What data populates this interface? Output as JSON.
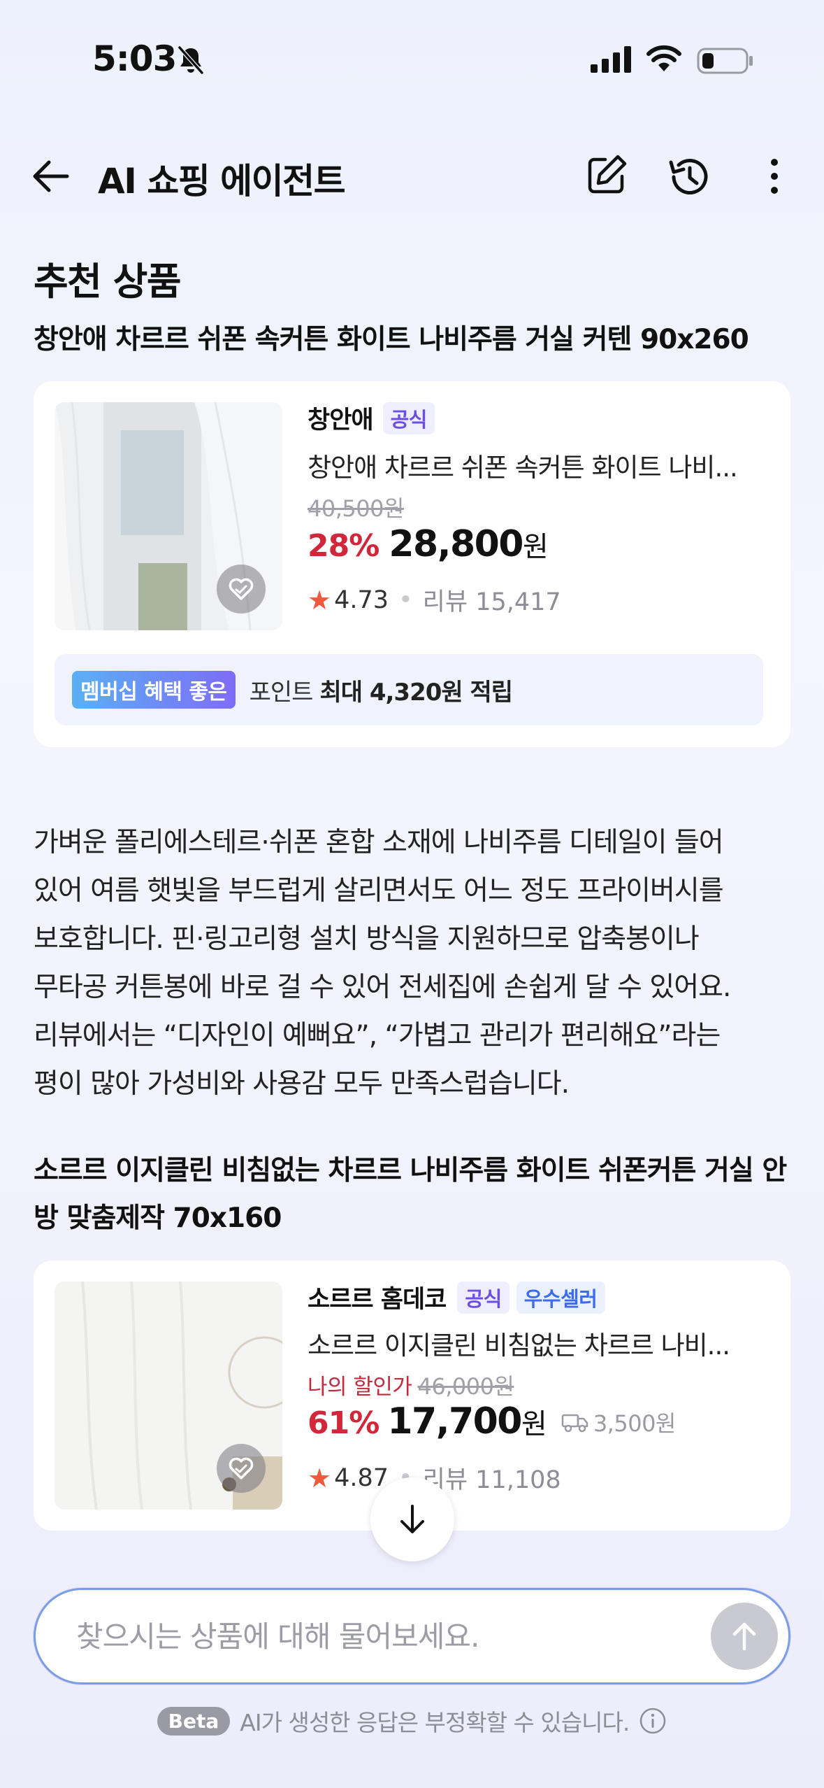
{
  "status_bar": {
    "time": "5:03"
  },
  "header": {
    "title": "AI 쇼핑 에이전트"
  },
  "section_title": "추천 상품",
  "products": [
    {
      "title": "창안애 차르르 쉬폰 속커튼 화이트 나비주름 거실 커텐 90x260",
      "seller": "창안애",
      "badges": [
        "공식"
      ],
      "name": "창안애 차르르 쉬폰 속커튼 화이트 나비...",
      "original_price": "40,500원",
      "discount": "28%",
      "price": "28,800",
      "price_unit": "원",
      "rating": "4.73",
      "review": "리뷰 15,417",
      "benefit": {
        "tag": "멤버십 혜택 좋은",
        "prefix": "포인트",
        "amount": "최대 4,320원 적립"
      }
    },
    {
      "title": "소르르 이지클린 비침없는 차르르 나비주름 화이트 쉬폰커튼 거실 안방 맞춤제작 70x160",
      "seller": "소르르 홈데코",
      "badges": [
        "공식",
        "우수셀러"
      ],
      "name": "소르르 이지클린 비침없는 차르르 나비...",
      "my_price_label": "나의 할인가",
      "original_price": "46,000원",
      "discount": "61%",
      "price": "17,700",
      "price_unit": "원",
      "shipping": "3,500원",
      "rating": "4.87",
      "review": "리뷰 11,108"
    }
  ],
  "description": [
    "가벼운 폴리에스테르·쉬폰 혼합 소재에 나비주름 디테일이 들어",
    "있어 여름 햇빛을 부드럽게 살리면서도 어느 정도 프라이버시를",
    "보호합니다. 핀·링고리형 설치 방식을 지원하므로 압축봉이나",
    "무타공 커튼봉에 바로 걸 수 있어 전세집에 손쉽게 달 수 있어요.",
    "리뷰에서는 “디자인이 예뻐요”, “가볍고 관리가 편리해요”라는",
    "평이 많아 가성비와 사용감 모두 만족스럽습니다."
  ],
  "chat": {
    "placeholder": "찾으시는 상품에 대해 물어보세요."
  },
  "footer": {
    "beta": "Beta",
    "disclaimer": "AI가 생성한 응답은 부정확할 수 있습니다."
  },
  "colors": {
    "discount": "#d2263b",
    "badge_official": "#6c4de6",
    "badge_top_seller": "#3d6cf0",
    "input_border": "#7a9ee6"
  }
}
